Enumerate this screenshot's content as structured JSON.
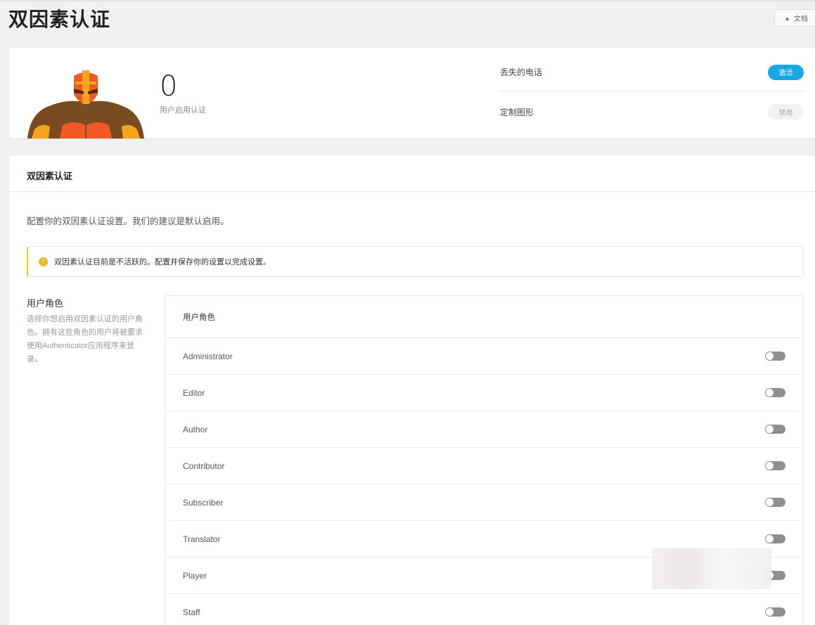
{
  "page": {
    "title": "双因素认证",
    "docs_label": "文档"
  },
  "summary": {
    "count": "0",
    "count_label": "用户启用认证",
    "features": [
      {
        "label": "丢失的电话",
        "action": "激活",
        "state": "active"
      },
      {
        "label": "定制图形",
        "action": "禁用",
        "state": "disabled"
      }
    ]
  },
  "settings": {
    "header": "双因素认证",
    "intro": "配置你的双因素认证设置。我们的建议是默认启用。",
    "notice": "双因素认证目前是不活跃的。配置并保存你的设置以完成设置。",
    "roles_section": {
      "title": "用户角色",
      "description": "选择你想启用双因素认证的用户角色。拥有这些角色的用户将被要求使用Authenticator应用程序来登录。",
      "list_header": "用户角色",
      "roles": [
        "Administrator",
        "Editor",
        "Author",
        "Contributor",
        "Subscriber",
        "Translator",
        "Player",
        "Staff"
      ]
    }
  },
  "colors": {
    "accent": "#17a8e3",
    "warning": "#f0b429",
    "toggle_off": "#8f8f8f"
  },
  "icons": {
    "docs": "graduation-cap-icon",
    "warning": "exclamation-circle-icon",
    "avatar": "masked-wrestler-icon"
  }
}
